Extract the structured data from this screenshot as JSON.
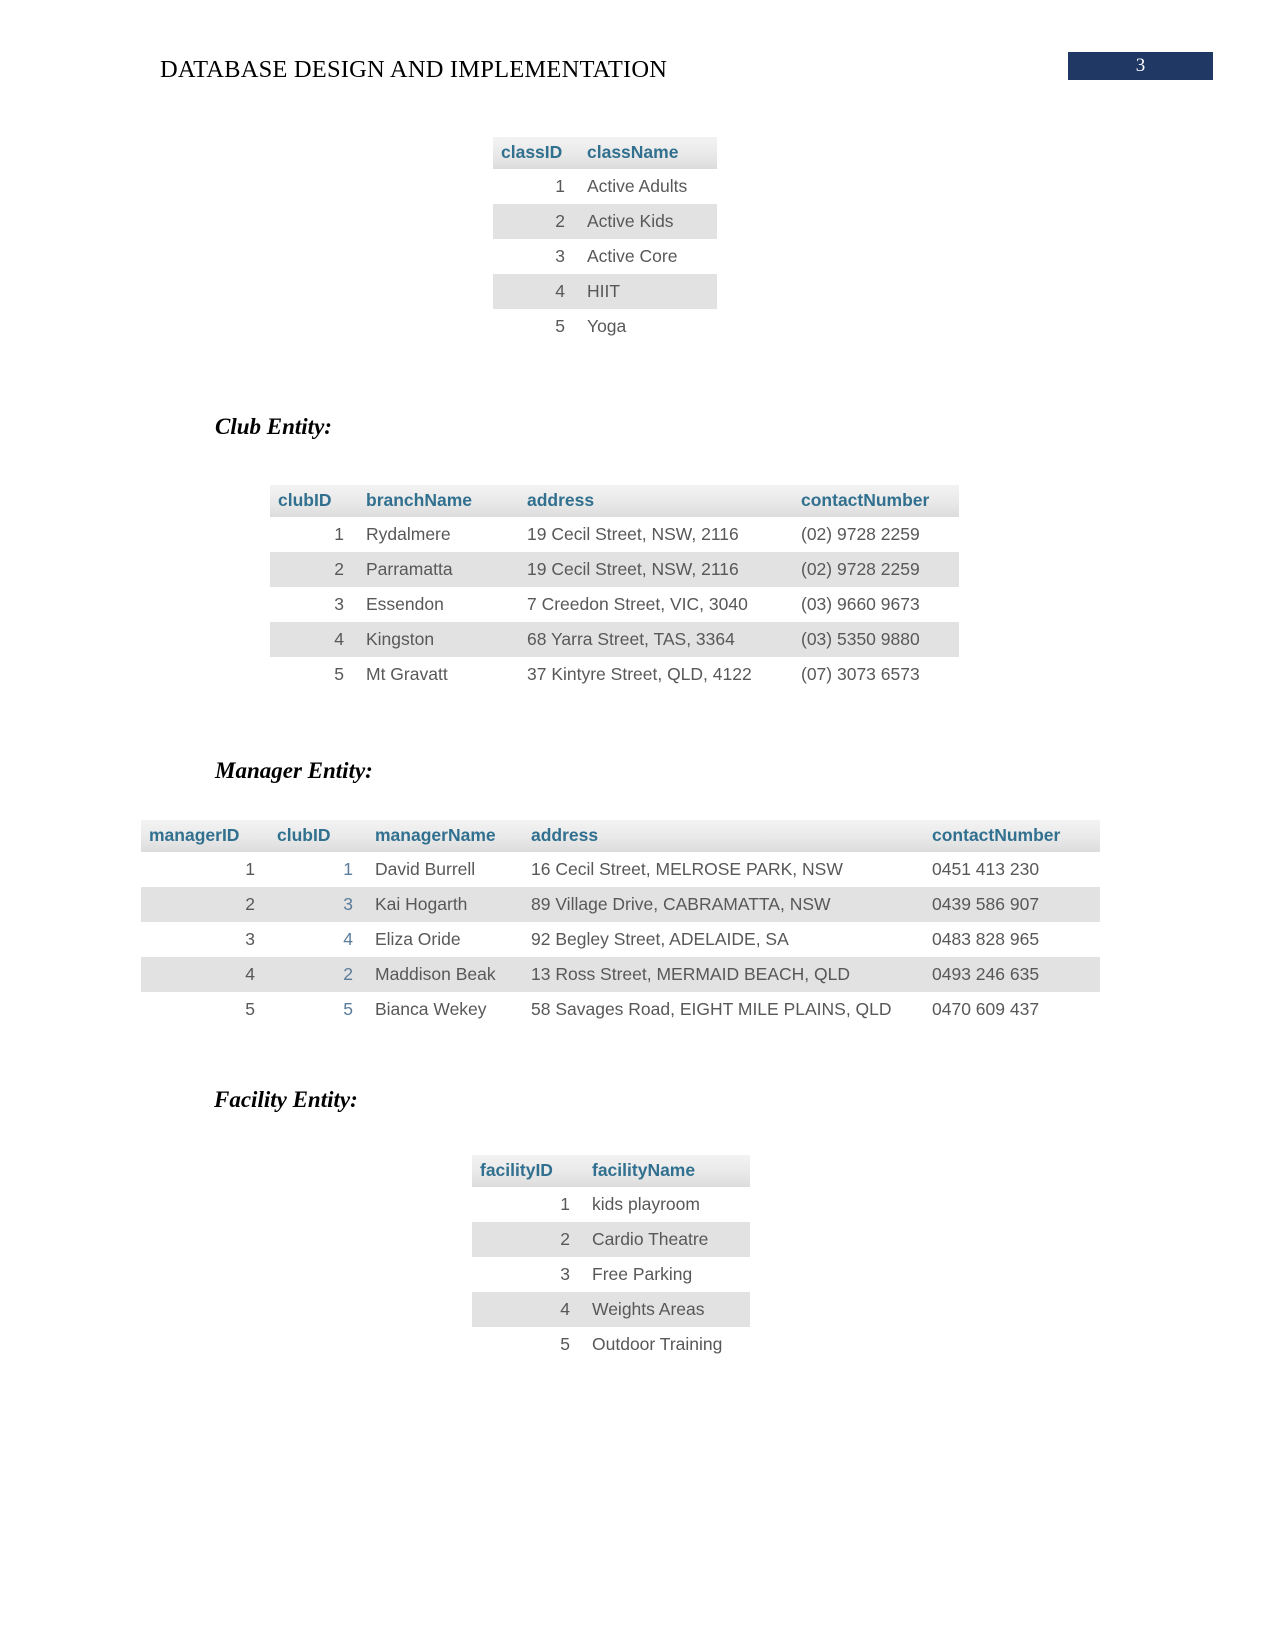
{
  "header": {
    "title": "DATABASE DESIGN AND IMPLEMENTATION",
    "page_number": "3",
    "badge_color": "#1f3864"
  },
  "headings": {
    "club": "Club Entity:",
    "manager": "Manager Entity:",
    "facility": "Facility Entity:"
  },
  "tables": {
    "class": {
      "columns": [
        "classID",
        "className"
      ],
      "rows": [
        [
          "1",
          "Active Adults"
        ],
        [
          "2",
          "Active Kids"
        ],
        [
          "3",
          "Active Core"
        ],
        [
          "4",
          "HIIT"
        ],
        [
          "5",
          "Yoga"
        ]
      ]
    },
    "club": {
      "columns": [
        "clubID",
        "branchName",
        "address",
        "contactNumber"
      ],
      "rows": [
        [
          "1",
          "Rydalmere",
          "19 Cecil Street, NSW, 2116",
          "(02) 9728 2259"
        ],
        [
          "2",
          "Parramatta",
          "19 Cecil Street, NSW, 2116",
          "(02) 9728 2259"
        ],
        [
          "3",
          "Essendon",
          "7 Creedon Street, VIC, 3040",
          "(03) 9660 9673"
        ],
        [
          "4",
          "Kingston",
          "68 Yarra Street, TAS, 3364",
          "(03) 5350 9880"
        ],
        [
          "5",
          "Mt Gravatt",
          "37 Kintyre Street, QLD, 4122",
          "(07) 3073 6573"
        ]
      ]
    },
    "manager": {
      "columns": [
        "managerID",
        "clubID",
        "managerName",
        "address",
        "contactNumber"
      ],
      "rows": [
        [
          "1",
          "1",
          "David Burrell",
          "16 Cecil Street, MELROSE PARK, NSW",
          "0451 413 230"
        ],
        [
          "2",
          "3",
          "Kai Hogarth",
          "89 Village Drive, CABRAMATTA, NSW",
          "0439 586 907"
        ],
        [
          "3",
          "4",
          "Eliza Oride",
          "92 Begley Street, ADELAIDE, SA",
          "0483 828 965"
        ],
        [
          "4",
          "2",
          "Maddison Beak",
          "13 Ross Street, MERMAID BEACH, QLD",
          "0493 246 635"
        ],
        [
          "5",
          "5",
          "Bianca Wekey",
          "58 Savages Road, EIGHT MILE PLAINS, QLD",
          "0470 609 437"
        ]
      ]
    },
    "facility": {
      "columns": [
        "facilityID",
        "facilityName"
      ],
      "rows": [
        [
          "1",
          "kids playroom"
        ],
        [
          "2",
          "Cardio Theatre"
        ],
        [
          "3",
          "Free Parking"
        ],
        [
          "4",
          "Weights Areas"
        ],
        [
          "5",
          "Outdoor Training"
        ]
      ]
    }
  }
}
